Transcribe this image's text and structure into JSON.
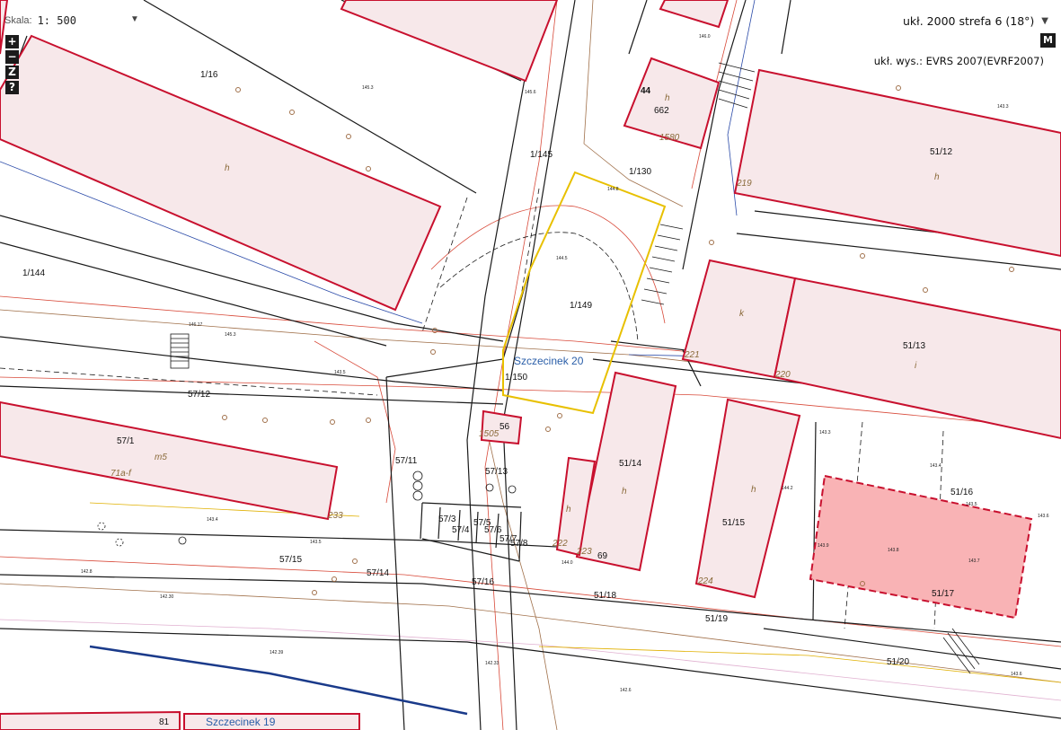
{
  "scale": {
    "label": "Skala:",
    "value": "1: 500"
  },
  "crs": {
    "value": "ukł. 2000 strefa 6 (18°)"
  },
  "height_system": "ukł. wys.: EVRS 2007(EVRF2007)",
  "controls": {
    "zoom_in": "+",
    "zoom_out": "−",
    "zoom_extent": "Z",
    "help": "?",
    "menu": "M"
  },
  "colors": {
    "building_fill": "#f7e8ea",
    "building_stroke": "#c8102e",
    "selected_fill": "#f9b3b5",
    "selected_stroke": "#c8102e",
    "highlight_parcel": "#e8c000",
    "road": "#1a1a1a",
    "utility_red": "#d84a3a",
    "utility_blue": "#2a4aa8",
    "utility_brown": "#a0704a"
  },
  "map": {
    "parcels": [
      "1/16",
      "1/144",
      "1/145",
      "1/130",
      "1/149",
      "1/150",
      "662",
      "51/12",
      "51/13",
      "51/14",
      "51/15",
      "51/16",
      "51/17",
      "51/18",
      "51/19",
      "51/20",
      "57/1",
      "57/12",
      "57/11",
      "57/13",
      "57/3",
      "57/4",
      "57/5",
      "57/6",
      "57/7",
      "57/8",
      "57/14",
      "57/15",
      "57/16",
      "56",
      "69",
      "44"
    ],
    "labels": {
      "p1_16": "1/16",
      "p1_144": "1/144",
      "p1_145": "1/145",
      "p1_130": "1/130",
      "p1_149": "1/149",
      "p1_150": "1/150",
      "p662": "662",
      "p51_12": "51/12",
      "p51_13": "51/13",
      "p51_14": "51/14",
      "p51_15": "51/15",
      "p51_16": "51/16",
      "p51_17": "51/17",
      "p51_18": "51/18",
      "p51_19": "51/19",
      "p51_20": "51/20",
      "p57_1": "57/1",
      "p57_12": "57/12",
      "p57_11": "57/11",
      "p57_13": "57/13",
      "p57_3": "57/3",
      "p57_4": "57/4",
      "p57_5": "57/5",
      "p57_6": "57/6",
      "p57_7": "57/7",
      "p57_8": "57/8",
      "p57_14": "57/14",
      "p57_15": "57/15",
      "p57_16": "57/16",
      "p56": "56",
      "p69": "69",
      "p44": "44",
      "p81": "81",
      "b_h": "h",
      "b_k": "k",
      "b_i": "i",
      "b_m5": "m5",
      "b_71af": "71a-f",
      "n1580": "1580",
      "n1505": "1505",
      "n219": "219",
      "n220": "220",
      "n221": "221",
      "n222": "222",
      "n223": "223",
      "n224": "224",
      "n233": "233",
      "street1": "Szczecinek 20",
      "street2": "Szczecinek 19"
    },
    "spot_heights": [
      "143.3",
      "143.4",
      "143.5",
      "143.6",
      "143.7",
      "143.8",
      "143.9",
      "144.0",
      "144.2",
      "144.5",
      "144.8",
      "145.3",
      "145.6",
      "146.0",
      "146.17",
      "142.8",
      "142.6",
      "142.30",
      "142.33",
      "142.39"
    ]
  }
}
